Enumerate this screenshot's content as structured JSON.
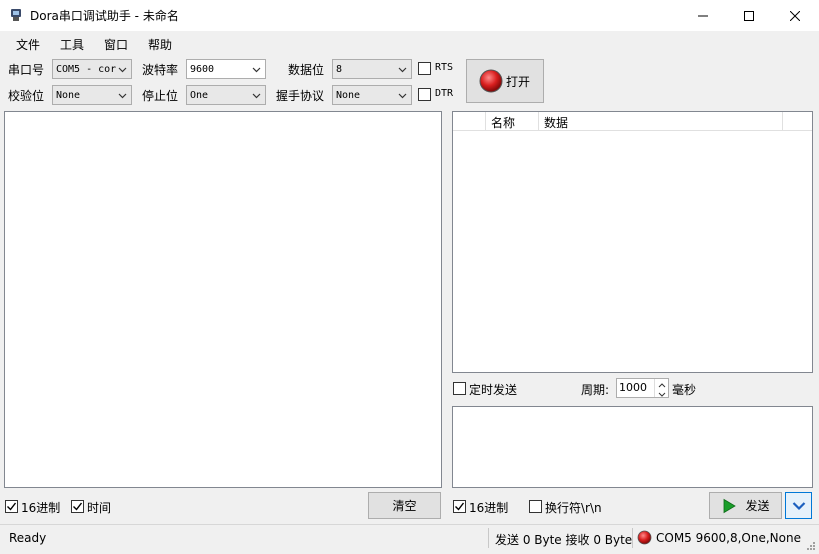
{
  "window": {
    "title": "Dora串口调试助手 - 未命名"
  },
  "menu": [
    "文件",
    "工具",
    "窗口",
    "帮助"
  ],
  "config": {
    "port_label": "串口号",
    "port_value": "COM5 - cor",
    "baud_label": "波特率",
    "baud_value": "9600",
    "databits_label": "数据位",
    "databits_value": "8",
    "parity_label": "校验位",
    "parity_value": "None",
    "stopbits_label": "停止位",
    "stopbits_value": "One",
    "handshake_label": "握手协议",
    "handshake_value": "None",
    "rts_label": "RTS",
    "dtr_label": "DTR",
    "open_button": "打开"
  },
  "receive": {
    "hex_label": "16进制",
    "hex_checked": true,
    "time_label": "时间",
    "time_checked": true,
    "clear_button": "清空"
  },
  "command_table": {
    "columns": [
      "名称",
      "数据"
    ]
  },
  "send": {
    "timed_label": "定时发送",
    "timed_checked": false,
    "period_label": "周期:",
    "period_value": "1000",
    "period_unit": "毫秒",
    "hex_label": "16进制",
    "hex_checked": true,
    "newline_label": "换行符\\r\\n",
    "newline_checked": false,
    "send_button": "发送"
  },
  "status": {
    "ready": "Ready",
    "counters": "发送 0 Byte 接收 0 Byte",
    "connection": "COM5 9600,8,One,None"
  },
  "colors": {
    "accent_red": "#d81e1e",
    "send_green": "#1a9e2a",
    "chevron_blue": "#1b5fbf"
  }
}
